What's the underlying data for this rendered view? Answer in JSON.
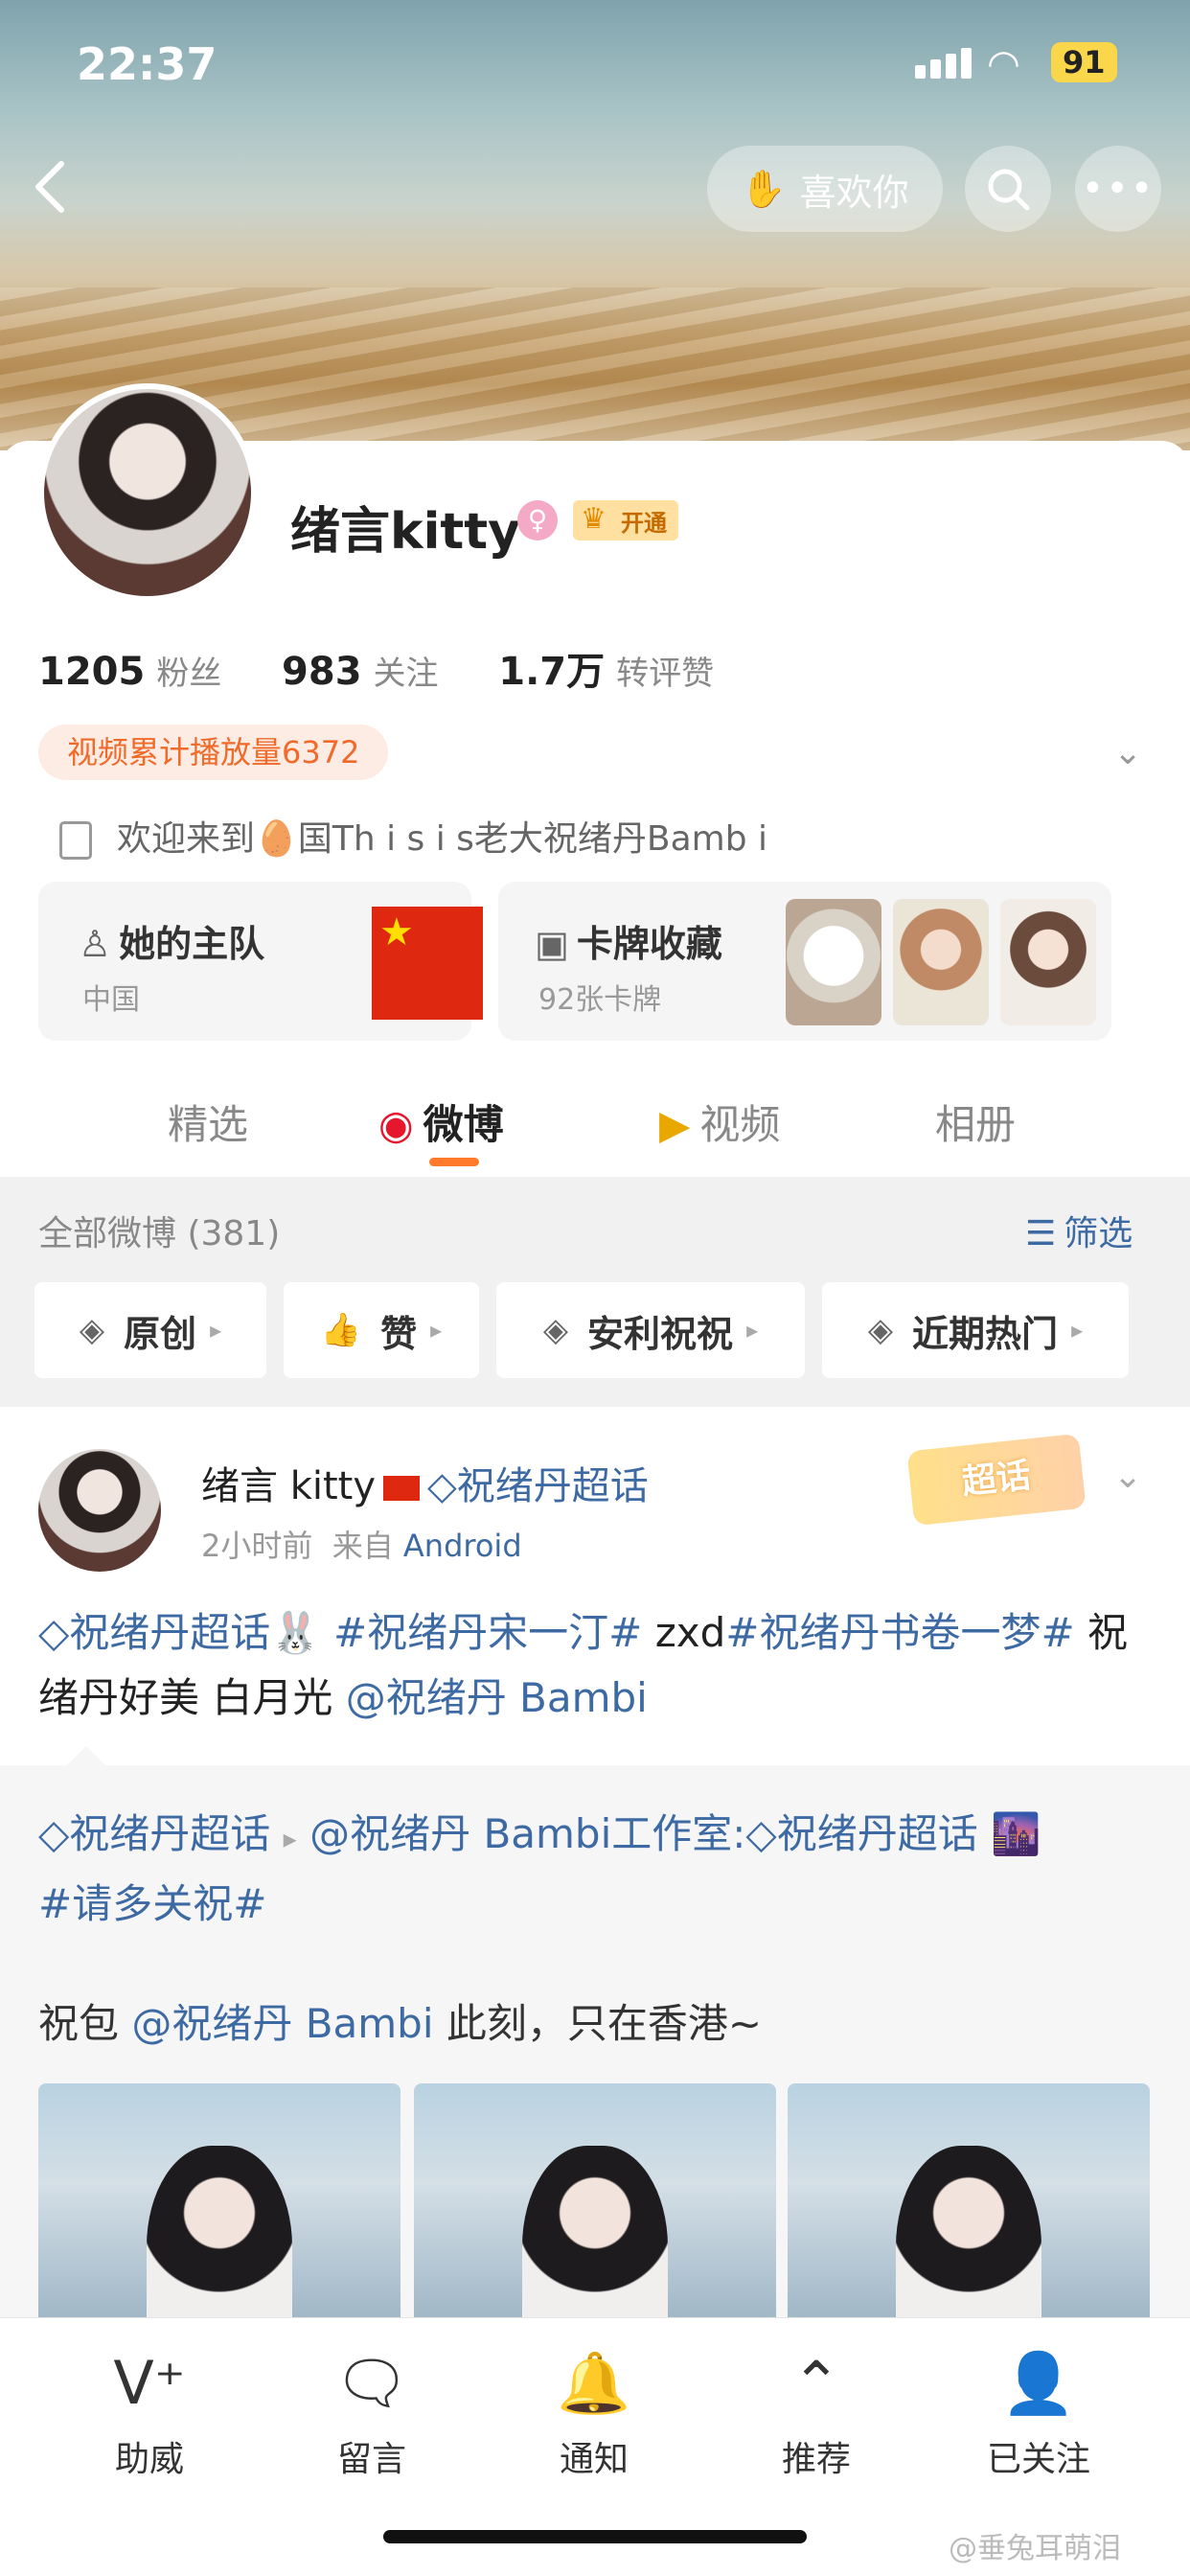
{
  "status": {
    "time": "22:37",
    "battery": "91"
  },
  "header": {
    "like_label": "喜欢你"
  },
  "profile": {
    "name": "绪言kitty",
    "vip_label": "开通",
    "followers_count": "1205",
    "followers_label": "粉丝",
    "following_count": "983",
    "following_label": "关注",
    "likes_count": "1.7万",
    "likes_label": "转评赞",
    "video_plays": "视频累计播放量6372",
    "bio": "欢迎来到🥚国Th i s  i s老大祝绪丹Bamb i"
  },
  "features": {
    "team_title": "她的主队",
    "team_sub": "中国",
    "cards_title": "卡牌收藏",
    "cards_sub": "92张卡牌"
  },
  "tabs": [
    "精选",
    "微博",
    "视频",
    "相册"
  ],
  "filter_bar": {
    "all_posts": "全部微博 (381)",
    "filter_label": "筛选"
  },
  "chips": [
    "原创",
    "赞",
    "安利祝祝",
    "近期热门"
  ],
  "post": {
    "author": "绪言 kitty",
    "topic": "祝绪丹超话",
    "time": "2小时前",
    "source_prefix": "来自",
    "source": "Android",
    "chaohua_badge": "超话",
    "text_topic1": "◇祝绪丹超话",
    "text_emoji": "🐰",
    "text_tag1": "#祝绪丹宋一汀#",
    "text_mid": " zxd",
    "text_tag2": "#祝绪丹书卷一梦#",
    "text_plain": " 祝绪丹好美  白月光 ",
    "text_mention": "@祝绪丹 Bambi"
  },
  "repost": {
    "topic": "◇祝绪丹超话",
    "mention": "@祝绪丹 Bambi工作室:",
    "topic2": "◇祝绪丹超话",
    "tag": "#请多关祝#",
    "line2_prefix": "祝包 ",
    "line2_mention": "@祝绪丹 Bambi",
    "line2_suffix": " 此刻，只在香港~"
  },
  "bottom_nav": [
    "助威",
    "留言",
    "通知",
    "推荐",
    "已关注"
  ],
  "watermark": "@垂兔耳萌泪"
}
